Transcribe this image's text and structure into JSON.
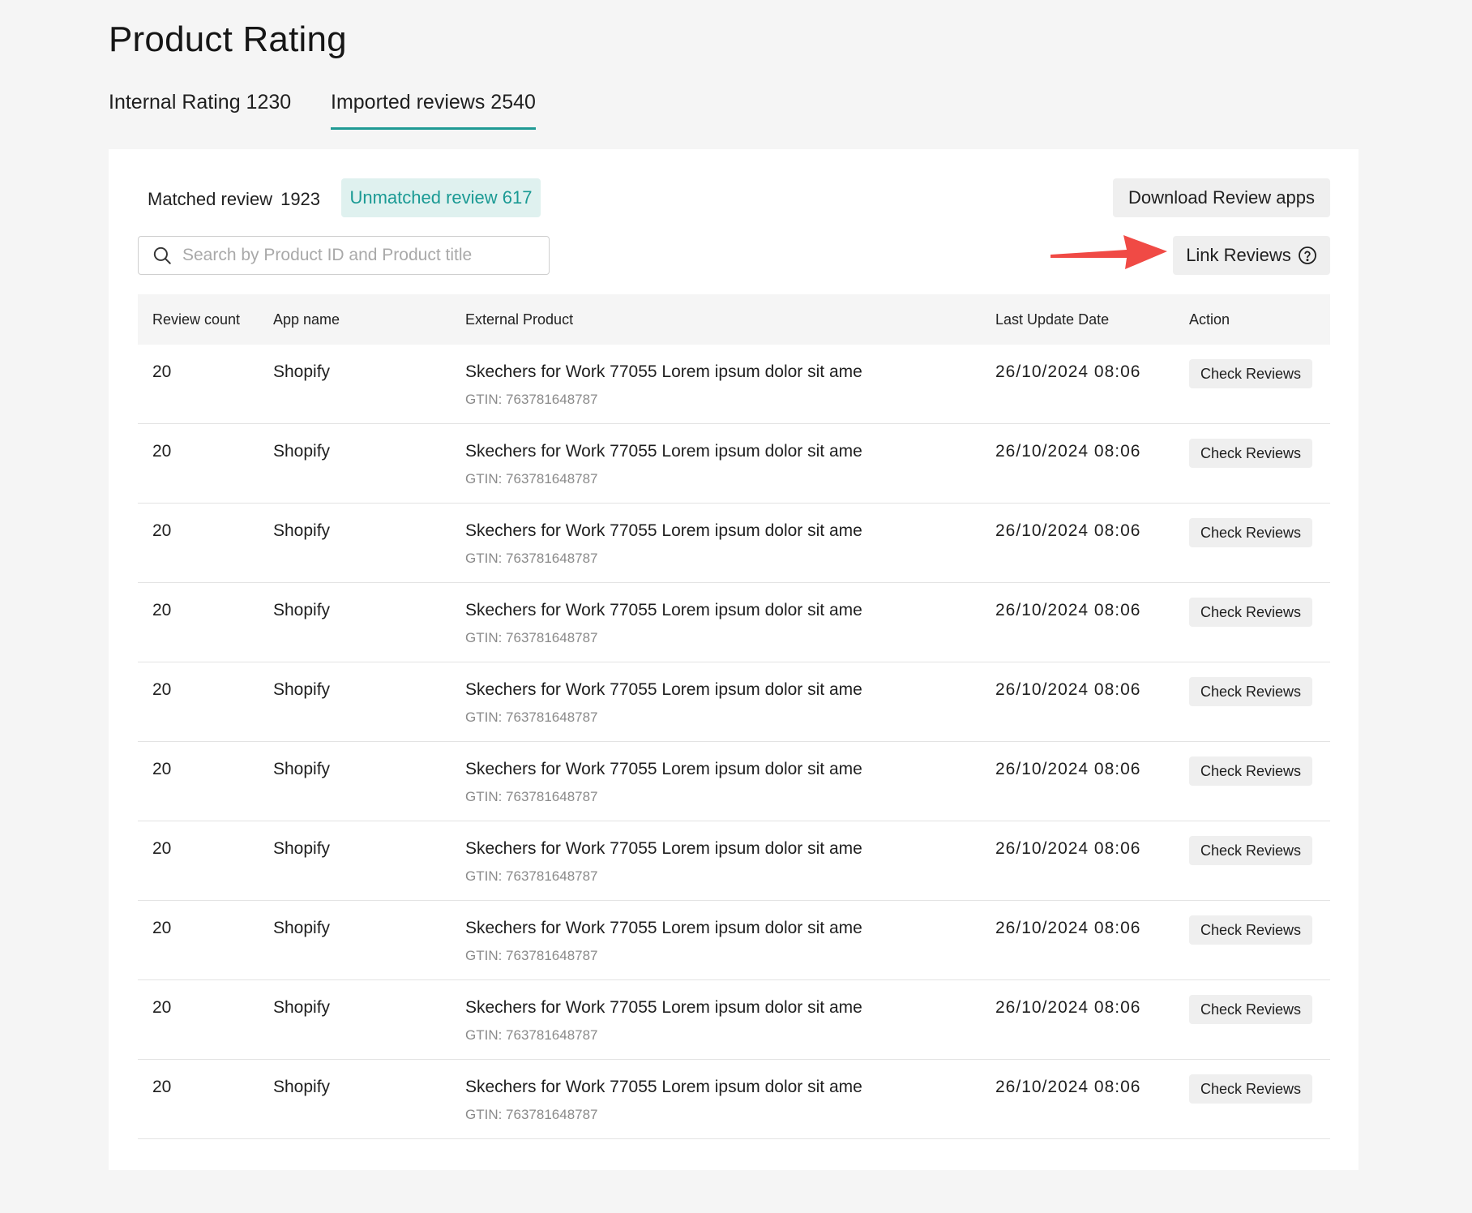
{
  "page": {
    "title": "Product Rating"
  },
  "tabs": [
    {
      "label": "Internal Rating 1230",
      "active": false
    },
    {
      "label": "Imported reviews 2540",
      "active": true
    }
  ],
  "filters": {
    "matched_label": "Matched review",
    "matched_count": "1923",
    "unmatched_label": "Unmatched review 617"
  },
  "actions": {
    "download_label": "Download Review apps",
    "link_label": "Link Reviews"
  },
  "search": {
    "placeholder": "Search by Product ID and Product title",
    "value": ""
  },
  "table": {
    "headers": [
      "Review count",
      "App name",
      "External Product",
      "Last Update Date",
      "Action"
    ],
    "rows": [
      {
        "count": "20",
        "app": "Shopify",
        "product": "Skechers for Work 77055 Lorem ipsum dolor sit ame",
        "gtin": "GTIN: 763781648787",
        "date": "26/10/2024 08:06",
        "action": "Check Reviews"
      },
      {
        "count": "20",
        "app": "Shopify",
        "product": "Skechers for Work 77055 Lorem ipsum dolor sit ame",
        "gtin": "GTIN: 763781648787",
        "date": "26/10/2024 08:06",
        "action": "Check Reviews"
      },
      {
        "count": "20",
        "app": "Shopify",
        "product": "Skechers for Work 77055 Lorem ipsum dolor sit ame",
        "gtin": "GTIN: 763781648787",
        "date": "26/10/2024 08:06",
        "action": "Check Reviews"
      },
      {
        "count": "20",
        "app": "Shopify",
        "product": "Skechers for Work 77055 Lorem ipsum dolor sit ame",
        "gtin": "GTIN: 763781648787",
        "date": "26/10/2024 08:06",
        "action": "Check Reviews"
      },
      {
        "count": "20",
        "app": "Shopify",
        "product": "Skechers for Work 77055 Lorem ipsum dolor sit ame",
        "gtin": "GTIN: 763781648787",
        "date": "26/10/2024 08:06",
        "action": "Check Reviews"
      },
      {
        "count": "20",
        "app": "Shopify",
        "product": "Skechers for Work 77055 Lorem ipsum dolor sit ame",
        "gtin": "GTIN: 763781648787",
        "date": "26/10/2024 08:06",
        "action": "Check Reviews"
      },
      {
        "count": "20",
        "app": "Shopify",
        "product": "Skechers for Work 77055 Lorem ipsum dolor sit ame",
        "gtin": "GTIN: 763781648787",
        "date": "26/10/2024 08:06",
        "action": "Check Reviews"
      },
      {
        "count": "20",
        "app": "Shopify",
        "product": "Skechers for Work 77055 Lorem ipsum dolor sit ame",
        "gtin": "GTIN: 763781648787",
        "date": "26/10/2024 08:06",
        "action": "Check Reviews"
      },
      {
        "count": "20",
        "app": "Shopify",
        "product": "Skechers for Work 77055 Lorem ipsum dolor sit ame",
        "gtin": "GTIN: 763781648787",
        "date": "26/10/2024 08:06",
        "action": "Check Reviews"
      },
      {
        "count": "20",
        "app": "Shopify",
        "product": "Skechers for Work 77055 Lorem ipsum dolor sit ame",
        "gtin": "GTIN: 763781648787",
        "date": "26/10/2024 08:06",
        "action": "Check Reviews"
      }
    ]
  },
  "icons": {
    "search": "search-icon",
    "help": "help-circle-icon",
    "annotation": "red-arrow-icon"
  },
  "colors": {
    "accent": "#1a9a94",
    "chip_bg": "#dff1ef",
    "arrow": "#f04a45",
    "background": "#f5f5f5"
  }
}
